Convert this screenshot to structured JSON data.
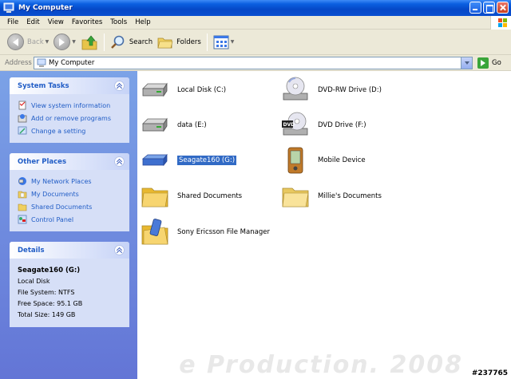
{
  "window": {
    "title": "My Computer"
  },
  "menu": [
    "File",
    "Edit",
    "View",
    "Favorites",
    "Tools",
    "Help"
  ],
  "toolbar": {
    "back": "Back",
    "search": "Search",
    "folders": "Folders"
  },
  "address": {
    "label": "Address",
    "value": "My Computer",
    "go": "Go"
  },
  "system_tasks": {
    "title": "System Tasks",
    "items": [
      "View system information",
      "Add or remove programs",
      "Change a setting"
    ]
  },
  "other_places": {
    "title": "Other Places",
    "items": [
      "My Network Places",
      "My Documents",
      "Shared Documents",
      "Control Panel"
    ]
  },
  "details": {
    "title": "Details",
    "name": "Seagate160 (G:)",
    "type": "Local Disk",
    "fs": "File System: NTFS",
    "free": "Free Space: 95.1 GB",
    "total": "Total Size: 149 GB"
  },
  "items": [
    {
      "label": "Local Disk (C:)",
      "icon": "hard-drive-icon"
    },
    {
      "label": "DVD-RW Drive (D:)",
      "icon": "cd-drive-icon"
    },
    {
      "label": "data (E:)",
      "icon": "hard-drive-icon"
    },
    {
      "label": "DVD Drive (F:)",
      "icon": "dvd-drive-icon"
    },
    {
      "label": "Seagate160 (G:)",
      "icon": "usb-drive-icon"
    },
    {
      "label": "Mobile Device",
      "icon": "pda-icon"
    },
    {
      "label": "Shared Documents",
      "icon": "folder-icon"
    },
    {
      "label": "Millie's Documents",
      "icon": "folder-icon"
    },
    {
      "label": "Sony Ericsson File Manager",
      "icon": "phone-folder-icon"
    }
  ],
  "watermark": "e Production. 2008",
  "stamp": "#237765"
}
